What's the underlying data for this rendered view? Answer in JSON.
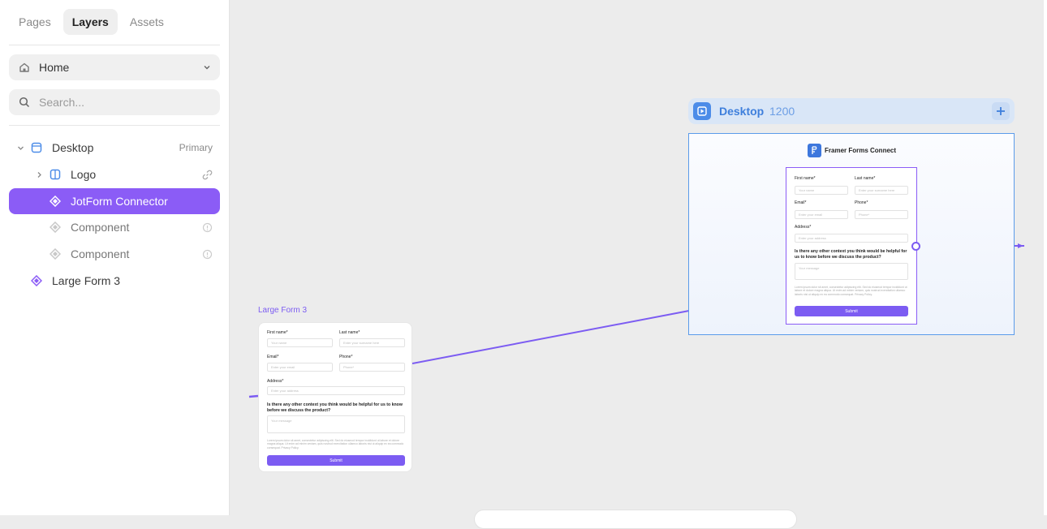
{
  "sidebar": {
    "tabs": [
      {
        "label": "Pages",
        "active": false
      },
      {
        "label": "Layers",
        "active": true
      },
      {
        "label": "Assets",
        "active": false
      }
    ],
    "page_select": {
      "value": "Home",
      "icon": "home-icon"
    },
    "search": {
      "placeholder": "Search...",
      "value": ""
    },
    "layers": [
      {
        "label": "Desktop",
        "right_label": "Primary",
        "icon": "frame-icon",
        "expanded": true
      },
      {
        "label": "Logo",
        "icon": "stack-icon",
        "right_icon": "link-icon",
        "collapsed": true
      },
      {
        "label": "JotForm Connector",
        "icon": "component-icon",
        "selected": true
      },
      {
        "label": "Component",
        "icon": "component-icon",
        "right_icon": "info-icon"
      },
      {
        "label": "Component",
        "icon": "component-icon",
        "right_icon": "info-icon"
      },
      {
        "label": "Large Form 3",
        "icon": "component-icon"
      }
    ]
  },
  "canvas": {
    "frame": {
      "title": "Desktop",
      "width_label": "1200"
    },
    "brand": {
      "name": "Framer Forms Connect"
    },
    "large_form_label": "Large Form 3",
    "form": {
      "first_name_label": "First name*",
      "first_name_placeholder": "Your name",
      "last_name_label": "Last name*",
      "last_name_placeholder": "Enter your surname here",
      "email_label": "Email*",
      "email_placeholder": "Enter your email",
      "phone_label": "Phone*",
      "phone_placeholder": "Phone*",
      "address_label": "Address*",
      "address_placeholder": "Enter your address",
      "question": "Is there any other context you think would be helpful for us to know before we discuss the product?",
      "message_placeholder": "Your message",
      "fine_print": "Lorem ipsum dolor sit amet, consectetur adipiscing elit. Sed do eiusmod tempor incididunt ut labore et dolore magna aliqua. Ut enim ad minim veniam, quis nostrud exercitation ullamco laboris nisi ut aliquip ex ea commodo consequat. Privacy Policy.",
      "submit_label": "Submit"
    }
  },
  "colors": {
    "accent": "#8b5cf6",
    "frame_blue": "#4c8ce8",
    "canvas_bg": "#ececec"
  }
}
